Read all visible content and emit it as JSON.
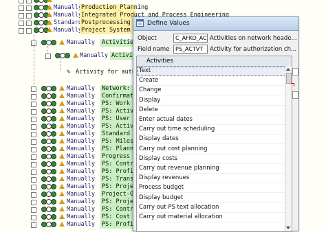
{
  "tree": {
    "rows": [
      {
        "status": "",
        "desc": "",
        "indent": 0
      },
      {
        "status": "Manually",
        "desc": "Production Planning",
        "indent": 0
      },
      {
        "status": "Manually",
        "desc": "Integrated Product and Process Engineering",
        "indent": 0
      },
      {
        "status": "Standard",
        "desc": "Postprocessing Of",
        "indent": 0
      },
      {
        "status": "Manually",
        "desc": "Project System",
        "indent": 0
      },
      {
        "status": "Manually",
        "desc": "Activities",
        "indent": 1
      },
      {
        "status": "Manually",
        "desc": "Activities",
        "indent": 2
      },
      {
        "status": "",
        "desc": "Activity for autho",
        "indent": 3
      },
      {
        "status": "Manually",
        "desc": "Network: M",
        "indent": 1
      },
      {
        "status": "Manually",
        "desc": "Confirmatio",
        "indent": 1
      },
      {
        "status": "Manually",
        "desc": "PS: Work C",
        "indent": 1
      },
      {
        "status": "Manually",
        "desc": "PS: Activi",
        "indent": 1
      },
      {
        "status": "Manually",
        "desc": "PS: User f",
        "indent": 1
      },
      {
        "status": "Manually",
        "desc": "PS: Activi",
        "indent": 1
      },
      {
        "status": "Manually",
        "desc": "Standard W",
        "indent": 1
      },
      {
        "status": "Manually",
        "desc": "PS: Milest",
        "indent": 1
      },
      {
        "status": "Manually",
        "desc": "PS: Planne",
        "indent": 1
      },
      {
        "status": "Manually",
        "desc": "Progress T",
        "indent": 1
      },
      {
        "status": "Manually",
        "desc": "PS: Contro",
        "indent": 1
      },
      {
        "status": "Manually",
        "desc": "PS: Profit",
        "indent": 1
      },
      {
        "status": "Manually",
        "desc": "PS: Transa",
        "indent": 1
      },
      {
        "status": "Manually",
        "desc": "PS: Projec",
        "indent": 1
      },
      {
        "status": "Manually",
        "desc": "Project-Or",
        "indent": 1
      },
      {
        "status": "Manually",
        "desc": "PS: Projec",
        "indent": 1
      },
      {
        "status": "Manually",
        "desc": "PS: Contro",
        "indent": 1
      },
      {
        "status": "Manually",
        "desc": "PS: Cost C",
        "indent": 1
      },
      {
        "status": "Manually",
        "desc": "PS: Profit",
        "indent": 1
      }
    ]
  },
  "dialog": {
    "title": "Define Values",
    "object_label": "Object",
    "object_value": "C_AFKO_ACT",
    "object_desc": "Activities on network heade...",
    "field_label": "Field name",
    "field_value": "PS_ACTVT",
    "field_desc": "Activity for authorization ch...",
    "list_header": "Activities",
    "items": [
      "Text",
      "Create",
      "Change",
      "Display",
      "Delete",
      "Enter actual dates",
      "Carry out time scheduling",
      "Display dates",
      "Carry out cost planning",
      "Display costs",
      "Carry out revenue planning",
      "Display revenues",
      "Process budget",
      "Display budget",
      "Carry out PS text allocation",
      "Carry out material allocation"
    ]
  }
}
